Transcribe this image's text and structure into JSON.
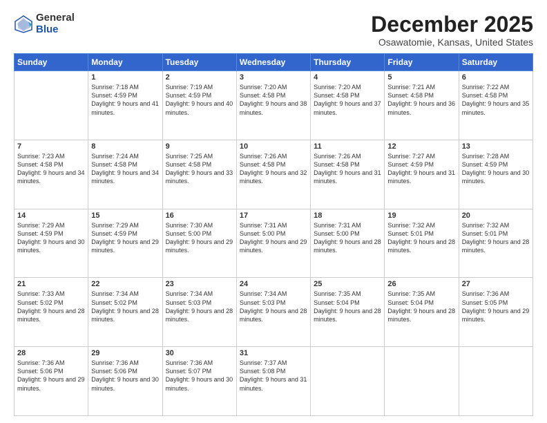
{
  "logo": {
    "general": "General",
    "blue": "Blue"
  },
  "header": {
    "title": "December 2025",
    "subtitle": "Osawatomie, Kansas, United States"
  },
  "weekdays": [
    "Sunday",
    "Monday",
    "Tuesday",
    "Wednesday",
    "Thursday",
    "Friday",
    "Saturday"
  ],
  "weeks": [
    [
      {
        "day": "",
        "sunrise": "",
        "sunset": "",
        "daylight": ""
      },
      {
        "day": "1",
        "sunrise": "Sunrise: 7:18 AM",
        "sunset": "Sunset: 4:59 PM",
        "daylight": "Daylight: 9 hours and 41 minutes."
      },
      {
        "day": "2",
        "sunrise": "Sunrise: 7:19 AM",
        "sunset": "Sunset: 4:59 PM",
        "daylight": "Daylight: 9 hours and 40 minutes."
      },
      {
        "day": "3",
        "sunrise": "Sunrise: 7:20 AM",
        "sunset": "Sunset: 4:58 PM",
        "daylight": "Daylight: 9 hours and 38 minutes."
      },
      {
        "day": "4",
        "sunrise": "Sunrise: 7:20 AM",
        "sunset": "Sunset: 4:58 PM",
        "daylight": "Daylight: 9 hours and 37 minutes."
      },
      {
        "day": "5",
        "sunrise": "Sunrise: 7:21 AM",
        "sunset": "Sunset: 4:58 PM",
        "daylight": "Daylight: 9 hours and 36 minutes."
      },
      {
        "day": "6",
        "sunrise": "Sunrise: 7:22 AM",
        "sunset": "Sunset: 4:58 PM",
        "daylight": "Daylight: 9 hours and 35 minutes."
      }
    ],
    [
      {
        "day": "7",
        "sunrise": "Sunrise: 7:23 AM",
        "sunset": "Sunset: 4:58 PM",
        "daylight": "Daylight: 9 hours and 34 minutes."
      },
      {
        "day": "8",
        "sunrise": "Sunrise: 7:24 AM",
        "sunset": "Sunset: 4:58 PM",
        "daylight": "Daylight: 9 hours and 34 minutes."
      },
      {
        "day": "9",
        "sunrise": "Sunrise: 7:25 AM",
        "sunset": "Sunset: 4:58 PM",
        "daylight": "Daylight: 9 hours and 33 minutes."
      },
      {
        "day": "10",
        "sunrise": "Sunrise: 7:26 AM",
        "sunset": "Sunset: 4:58 PM",
        "daylight": "Daylight: 9 hours and 32 minutes."
      },
      {
        "day": "11",
        "sunrise": "Sunrise: 7:26 AM",
        "sunset": "Sunset: 4:58 PM",
        "daylight": "Daylight: 9 hours and 31 minutes."
      },
      {
        "day": "12",
        "sunrise": "Sunrise: 7:27 AM",
        "sunset": "Sunset: 4:59 PM",
        "daylight": "Daylight: 9 hours and 31 minutes."
      },
      {
        "day": "13",
        "sunrise": "Sunrise: 7:28 AM",
        "sunset": "Sunset: 4:59 PM",
        "daylight": "Daylight: 9 hours and 30 minutes."
      }
    ],
    [
      {
        "day": "14",
        "sunrise": "Sunrise: 7:29 AM",
        "sunset": "Sunset: 4:59 PM",
        "daylight": "Daylight: 9 hours and 30 minutes."
      },
      {
        "day": "15",
        "sunrise": "Sunrise: 7:29 AM",
        "sunset": "Sunset: 4:59 PM",
        "daylight": "Daylight: 9 hours and 29 minutes."
      },
      {
        "day": "16",
        "sunrise": "Sunrise: 7:30 AM",
        "sunset": "Sunset: 5:00 PM",
        "daylight": "Daylight: 9 hours and 29 minutes."
      },
      {
        "day": "17",
        "sunrise": "Sunrise: 7:31 AM",
        "sunset": "Sunset: 5:00 PM",
        "daylight": "Daylight: 9 hours and 29 minutes."
      },
      {
        "day": "18",
        "sunrise": "Sunrise: 7:31 AM",
        "sunset": "Sunset: 5:00 PM",
        "daylight": "Daylight: 9 hours and 28 minutes."
      },
      {
        "day": "19",
        "sunrise": "Sunrise: 7:32 AM",
        "sunset": "Sunset: 5:01 PM",
        "daylight": "Daylight: 9 hours and 28 minutes."
      },
      {
        "day": "20",
        "sunrise": "Sunrise: 7:32 AM",
        "sunset": "Sunset: 5:01 PM",
        "daylight": "Daylight: 9 hours and 28 minutes."
      }
    ],
    [
      {
        "day": "21",
        "sunrise": "Sunrise: 7:33 AM",
        "sunset": "Sunset: 5:02 PM",
        "daylight": "Daylight: 9 hours and 28 minutes."
      },
      {
        "day": "22",
        "sunrise": "Sunrise: 7:34 AM",
        "sunset": "Sunset: 5:02 PM",
        "daylight": "Daylight: 9 hours and 28 minutes."
      },
      {
        "day": "23",
        "sunrise": "Sunrise: 7:34 AM",
        "sunset": "Sunset: 5:03 PM",
        "daylight": "Daylight: 9 hours and 28 minutes."
      },
      {
        "day": "24",
        "sunrise": "Sunrise: 7:34 AM",
        "sunset": "Sunset: 5:03 PM",
        "daylight": "Daylight: 9 hours and 28 minutes."
      },
      {
        "day": "25",
        "sunrise": "Sunrise: 7:35 AM",
        "sunset": "Sunset: 5:04 PM",
        "daylight": "Daylight: 9 hours and 28 minutes."
      },
      {
        "day": "26",
        "sunrise": "Sunrise: 7:35 AM",
        "sunset": "Sunset: 5:04 PM",
        "daylight": "Daylight: 9 hours and 28 minutes."
      },
      {
        "day": "27",
        "sunrise": "Sunrise: 7:36 AM",
        "sunset": "Sunset: 5:05 PM",
        "daylight": "Daylight: 9 hours and 29 minutes."
      }
    ],
    [
      {
        "day": "28",
        "sunrise": "Sunrise: 7:36 AM",
        "sunset": "Sunset: 5:06 PM",
        "daylight": "Daylight: 9 hours and 29 minutes."
      },
      {
        "day": "29",
        "sunrise": "Sunrise: 7:36 AM",
        "sunset": "Sunset: 5:06 PM",
        "daylight": "Daylight: 9 hours and 30 minutes."
      },
      {
        "day": "30",
        "sunrise": "Sunrise: 7:36 AM",
        "sunset": "Sunset: 5:07 PM",
        "daylight": "Daylight: 9 hours and 30 minutes."
      },
      {
        "day": "31",
        "sunrise": "Sunrise: 7:37 AM",
        "sunset": "Sunset: 5:08 PM",
        "daylight": "Daylight: 9 hours and 31 minutes."
      },
      {
        "day": "",
        "sunrise": "",
        "sunset": "",
        "daylight": ""
      },
      {
        "day": "",
        "sunrise": "",
        "sunset": "",
        "daylight": ""
      },
      {
        "day": "",
        "sunrise": "",
        "sunset": "",
        "daylight": ""
      }
    ]
  ]
}
